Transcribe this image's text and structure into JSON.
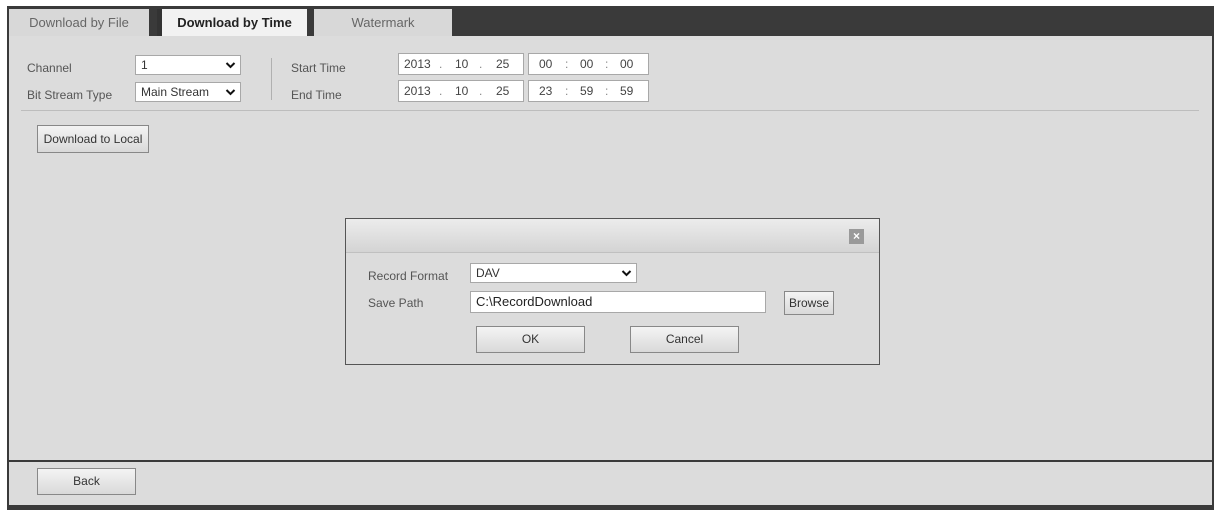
{
  "tabs": [
    {
      "label": "Download by File"
    },
    {
      "label": "Download by Time"
    },
    {
      "label": "Watermark"
    }
  ],
  "filters": {
    "channel_label": "Channel",
    "channel_value": "1",
    "bitstream_label": "Bit Stream Type",
    "bitstream_value": "Main Stream",
    "start_label": "Start Time",
    "end_label": "End Time",
    "start": {
      "year": "2013",
      "month": "10",
      "day": "25",
      "hour": "00",
      "minute": "00",
      "second": "00"
    },
    "end": {
      "year": "2013",
      "month": "10",
      "day": "25",
      "hour": "23",
      "minute": "59",
      "second": "59"
    }
  },
  "actions": {
    "download_local": "Download to Local",
    "back": "Back"
  },
  "dialog": {
    "close_glyph": "×",
    "record_format_label": "Record Format",
    "record_format_value": "DAV",
    "save_path_label": "Save Path",
    "save_path_value": "C:\\RecordDownload",
    "browse": "Browse",
    "ok": "OK",
    "cancel": "Cancel"
  },
  "icons": {
    "dropdown": "chevron-down-icon",
    "close": "close-icon"
  },
  "colors": {
    "frame": "#3a3a3a",
    "panel": "#dcdcdc",
    "active_tab": "#f2f2f2"
  }
}
